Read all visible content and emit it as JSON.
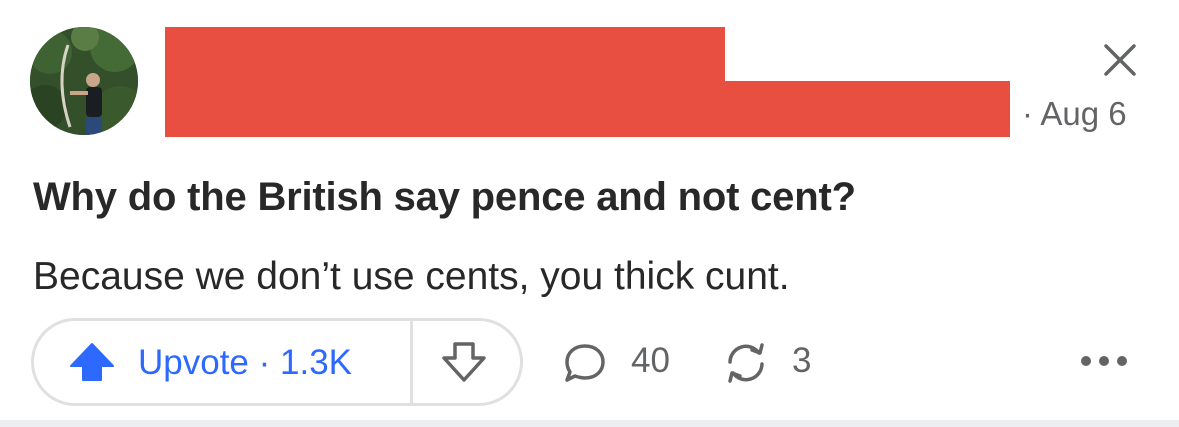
{
  "post": {
    "date_separator": "·",
    "date": "Aug 6",
    "question": "Why do the British say pence and not cent?",
    "answer": "Because we don’t use cents, you thick cunt."
  },
  "actions": {
    "upvote_label": "Upvote",
    "upvote_separator": "·",
    "upvote_count": "1.3K",
    "comment_count": "40",
    "share_count": "3"
  },
  "icons": {
    "close": "close-icon",
    "upvote": "arrow-up-icon",
    "downvote": "arrow-down-icon",
    "comment": "comment-icon",
    "share": "share-icon",
    "more": "more-horizontal-icon"
  },
  "colors": {
    "accent": "#2e69ff",
    "redaction": "#e94f40",
    "text": "#282829",
    "muted": "#636466",
    "border": "#dee0e1"
  }
}
